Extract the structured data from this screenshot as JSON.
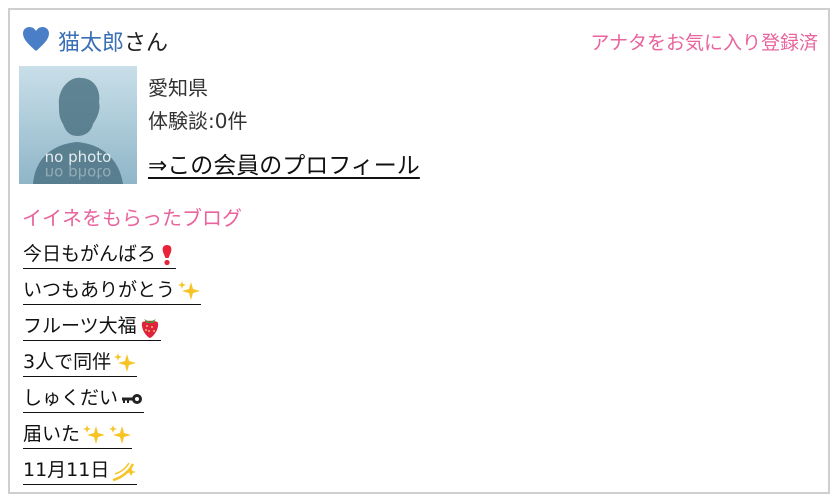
{
  "member": {
    "name": "猫太郎",
    "suffix": "さん",
    "favorite_status": "アナタをお気に入り登録済",
    "prefecture": "愛知県",
    "review_count": "体験談:0件",
    "profile_link": "⇒この会員のプロフィール",
    "avatar_text": "no photo",
    "heart_color": "#4a7fc8"
  },
  "blog": {
    "heading": "イイネをもらったブログ",
    "items": [
      {
        "text": "今日もがんばろ",
        "emoji_icon": "exclamation-icon"
      },
      {
        "text": "いつもありがとう",
        "emoji_icon": "sparkles-icon"
      },
      {
        "text": "フルーツ大福",
        "emoji_icon": "strawberry-icon"
      },
      {
        "text": "3人で同伴",
        "emoji_icon": "sparkles-icon"
      },
      {
        "text": "しゅくだい",
        "emoji_icon": "key-icon"
      },
      {
        "text": "届いた",
        "emoji_icon": "double-sparkles-icon"
      },
      {
        "text": "11月11日",
        "emoji_icon": "shooting-star-icon"
      }
    ]
  },
  "colors": {
    "accent_pink": "#e9639c",
    "link_blue": "#3a6fb5",
    "border": "#cfcfcf"
  }
}
